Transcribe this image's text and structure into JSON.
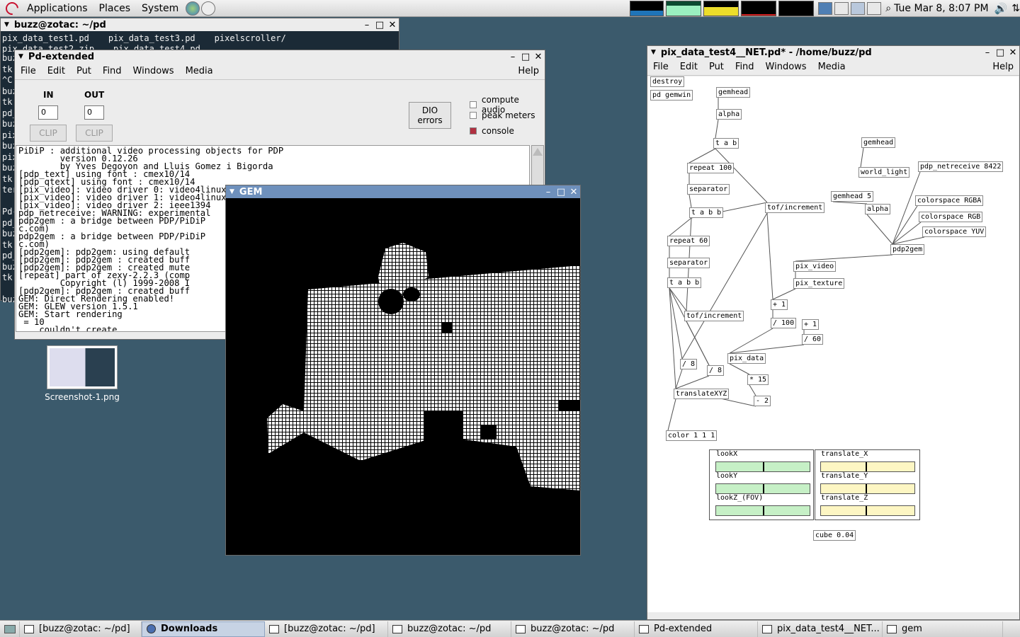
{
  "top_panel": {
    "menus": [
      "Applications",
      "Places",
      "System"
    ],
    "clock": "Tue Mar  8,  8:07 PM"
  },
  "terminal": {
    "title": "buzz@zotac: ~/pd",
    "files_row1": [
      "pix_data_test1.pd",
      "pix_data_test3.pd",
      "pixelscroller/"
    ],
    "files_row2": [
      "pix_data_test2.zip",
      "pix_data_test4.pd"
    ],
    "side_lines": [
      "buz",
      "tk",
      "^C",
      "buz",
      "tk",
      "pd_",
      "buz",
      "pix",
      "buz",
      "pix",
      "buz",
      "tk",
      "ter",
      "",
      "Pd-",
      "pd_",
      "buz",
      "tk",
      "pd_",
      "buz",
      "tk",
      "",
      "buz"
    ]
  },
  "pd_extended": {
    "title": "Pd-extended",
    "menu": [
      "File",
      "Edit",
      "Put",
      "Find",
      "Windows",
      "Media"
    ],
    "help": "Help",
    "in_label": "IN",
    "out_label": "OUT",
    "in_value": "0",
    "out_value": "0",
    "clip": "CLIP",
    "dio_line1": "DIO",
    "dio_line2": "errors",
    "compute_audio": "compute audio",
    "peak_meters": "peak meters",
    "console_label": "console",
    "console_lines": [
      "PiDiP : additional video processing objects for PDP",
      "        version 0.12.26",
      "        by Yves Degoyon and Lluis Gomez i Bigorda",
      "[pdp_text] using font : cmex10/14",
      "[pdp_qtext] using font : cmex10/14",
      "[pix_video]: video driver 0: video4linux2",
      "[pix_video]: video driver 1: video4linux",
      "[pix_video]: video driver 2: ieee1394",
      "pdp_netreceive: WARNING: experimental",
      "pdp2gem : a bridge between PDP/PiDiP",
      "c.com)",
      "pdp2gem : a bridge between PDP/PiDiP",
      "c.com)",
      "[pdp2gem]: pdp2gem: using default",
      "[pdp2gem]: pdp2gem : created buff",
      "[pdp2gem]: pdp2gem : created mute",
      "[repeat] part of zexy-2.2.3 (comp",
      "        Copyright (l) 1999-2008 I",
      "[pdp2gem]: pdp2gem : created buff",
      "GEM: Direct Rendering enabled!",
      "GEM: GLEW version 1.5.1",
      "GEM: Start rendering",
      " = 10",
      "... couldn't create"
    ]
  },
  "gem": {
    "title": "GEM"
  },
  "desktop_icon": {
    "label": "Screenshot-1.png"
  },
  "patch": {
    "title": "pix_data_test4__NET.pd* - /home/buzz/pd",
    "menu": [
      "File",
      "Edit",
      "Put",
      "Find",
      "Windows",
      "Media"
    ],
    "help": "Help",
    "objects": [
      "destroy",
      "pd gemwin",
      "gemhead",
      "alpha",
      "t a b",
      "repeat 100",
      "separator",
      "t a b b",
      "tof/increment",
      "repeat 60",
      "separator",
      "t a b b",
      "tof/increment",
      "/ 8",
      "/ 8",
      "translateXYZ",
      "color 1 1 1",
      "gemhead",
      "world_light",
      "pdp_netreceive 8422",
      "gemhead 5",
      "alpha",
      "colorspace RGBA",
      "colorspace RGB",
      "colorspace YUV",
      "pdp2gem",
      "pix_video",
      "pix_texture",
      "+ 1",
      "/ 100",
      "+ 1",
      "/ 60",
      "pix_data",
      "* 15",
      "- 2",
      "cube 0.04"
    ],
    "sliders_left": [
      "lookX",
      "lookY",
      "lookZ_(FOV)"
    ],
    "sliders_right": [
      "translate_X",
      "translate_Y",
      "translate_Z"
    ],
    "slider_values_left": [
      0.5,
      0.5,
      0.5
    ],
    "slider_values_right": [
      0.48,
      0.48,
      0.48
    ]
  },
  "taskbar": [
    {
      "label": "[buzz@zotac: ~/pd]",
      "active": false
    },
    {
      "label": "Downloads",
      "active": true
    },
    {
      "label": "[buzz@zotac: ~/pd]",
      "active": false
    },
    {
      "label": "buzz@zotac: ~/pd",
      "active": false
    },
    {
      "label": "buzz@zotac: ~/pd",
      "active": false
    },
    {
      "label": "Pd-extended",
      "active": false
    },
    {
      "label": "pix_data_test4__NET...",
      "active": false
    },
    {
      "label": "gem",
      "active": false
    }
  ],
  "colors": {
    "desktop": "#3b5a6c",
    "slider_green": "#c6f0c6",
    "slider_yellow": "#fdf6c3",
    "console_toggle": "#b03040"
  }
}
